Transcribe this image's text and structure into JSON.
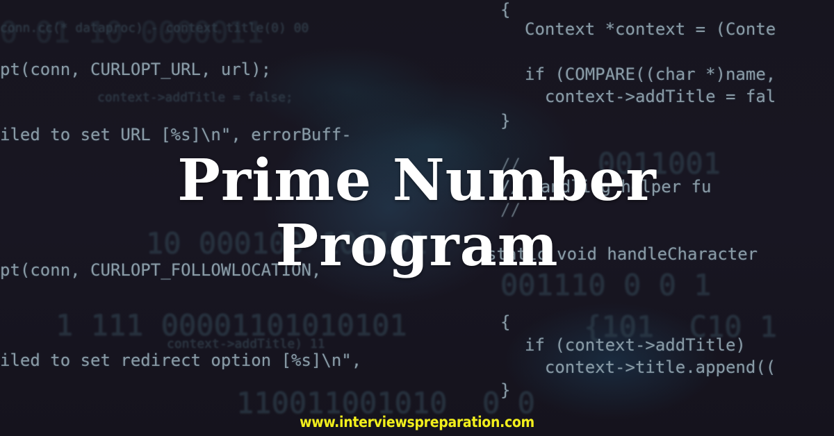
{
  "banner": {
    "title_line1": "Prime Number",
    "title_line2": "Program",
    "website_url": "www.interviewspreparation.com",
    "colors": {
      "background": "#16141f",
      "title": "#ffffff",
      "url": "#f2ef1c",
      "code_text": "#8a9ba6"
    }
  },
  "background_code": {
    "left": [
      "pt(conn, CURLOPT_URL, url);",
      "iled to set URL [%s]\\n\", errorBuff-",
      "pt(conn, CURLOPT_FOLLOWLOCATION,",
      "iled to set redirect option [%s]\\n\","
    ],
    "right": [
      "{",
      "Context *context = (Conte",
      "if (COMPARE((char *)name,",
      "  context->addTitle = fal",
      "}",
      "//",
      "// handling helper fu",
      "//",
      "static void handleCharacter",
      "{",
      "if (context->addTitle)",
      "  context->title.append((",
      "}"
    ],
    "faint": [
      "conn.cc(* dataproc) - context title(0) 00",
      "context->addTitle = false;",
      "10 000100 101101",
      "1 111 00001101010101",
      "110011001010  0 0",
      "0 01 10 0000011",
      "0011001",
      "001110 0 0 1",
      "{101  C10 1",
      "context->addTitle) 11"
    ]
  }
}
